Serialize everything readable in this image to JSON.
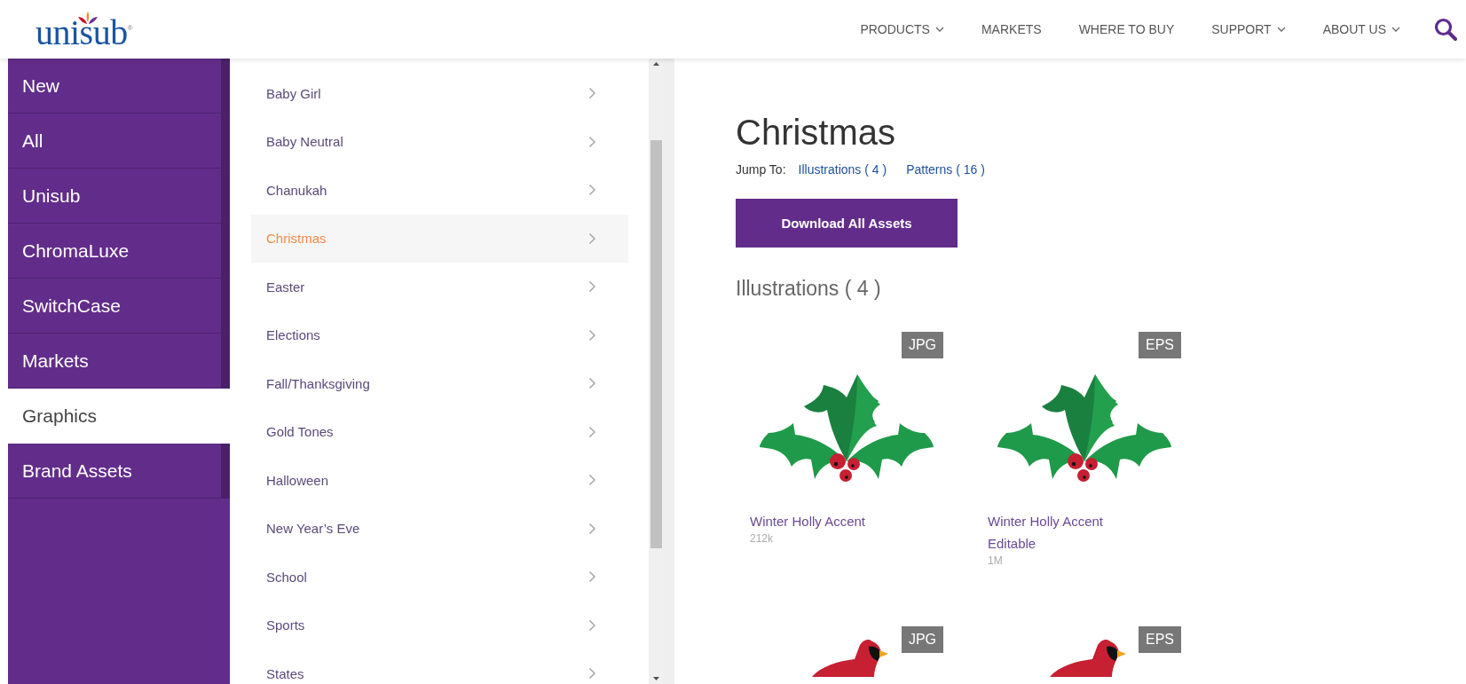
{
  "logo": {
    "text": "unisub",
    "mark": "®"
  },
  "nav": [
    {
      "label": "PRODUCTS",
      "has_menu": true
    },
    {
      "label": "MARKETS",
      "has_menu": false
    },
    {
      "label": "WHERE TO BUY",
      "has_menu": false
    },
    {
      "label": "SUPPORT",
      "has_menu": true
    },
    {
      "label": "ABOUT US",
      "has_menu": true
    }
  ],
  "sidebar": {
    "items": [
      {
        "label": "New",
        "selected": false
      },
      {
        "label": "All",
        "selected": false
      },
      {
        "label": "Unisub",
        "selected": false
      },
      {
        "label": "ChromaLuxe",
        "selected": false
      },
      {
        "label": "SwitchCase",
        "selected": false
      },
      {
        "label": "Markets",
        "selected": false
      },
      {
        "label": "Graphics",
        "selected": true
      },
      {
        "label": "Brand Assets",
        "selected": false
      }
    ]
  },
  "categories": [
    {
      "label": "Baby Girl",
      "selected": false
    },
    {
      "label": "Baby Neutral",
      "selected": false
    },
    {
      "label": "Chanukah",
      "selected": false
    },
    {
      "label": "Christmas",
      "selected": true
    },
    {
      "label": "Easter",
      "selected": false
    },
    {
      "label": "Elections",
      "selected": false
    },
    {
      "label": "Fall/Thanksgiving",
      "selected": false
    },
    {
      "label": "Gold Tones",
      "selected": false
    },
    {
      "label": "Halloween",
      "selected": false
    },
    {
      "label": "New Year’s Eve",
      "selected": false
    },
    {
      "label": "School",
      "selected": false
    },
    {
      "label": "Sports",
      "selected": false
    },
    {
      "label": "States",
      "selected": false
    }
  ],
  "content": {
    "title": "Christmas",
    "jump_label": "Jump To:",
    "jump_links": [
      "Illustrations ( 4 )",
      "Patterns ( 16 )"
    ],
    "download_button": "Download All Assets",
    "section_title": "Illustrations ( 4 )",
    "assets": [
      {
        "kind": "holly",
        "format": "JPG",
        "title": "Winter Holly Accent",
        "size": "212k"
      },
      {
        "kind": "holly",
        "format": "EPS",
        "title": "Winter Holly Accent Editable",
        "size": "1M"
      },
      {
        "kind": "cardinal",
        "format": "JPG"
      },
      {
        "kind": "cardinal",
        "format": "EPS"
      }
    ]
  }
}
